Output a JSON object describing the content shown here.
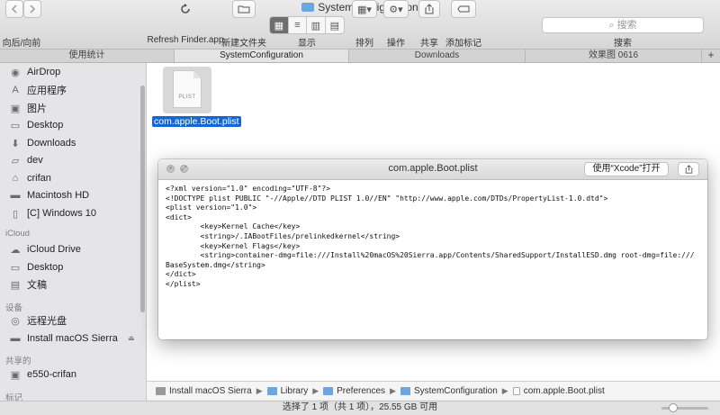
{
  "window": {
    "title": "SystemConfiguration"
  },
  "toolbar": {
    "back_forward_label": "向后/向前",
    "refresh_label": "Refresh Finder.app",
    "new_folder_label": "新建文件夹",
    "view_label": "显示",
    "arrange_label": "排列",
    "action_label": "操作",
    "share_label": "共享",
    "tags_label": "添加标记",
    "search_label": "搜索",
    "search_placeholder": "搜索"
  },
  "tabs": [
    {
      "label": "使用统计",
      "active": false
    },
    {
      "label": "SystemConfiguration",
      "active": true
    },
    {
      "label": "Downloads",
      "active": false
    },
    {
      "label": "效果图 0616",
      "active": false
    }
  ],
  "tab_add": "+",
  "sidebar": {
    "favorites": [
      {
        "label": "AirDrop",
        "icon": "airdrop-icon"
      },
      {
        "label": "应用程序",
        "icon": "applications-icon"
      },
      {
        "label": "图片",
        "icon": "camera-icon"
      },
      {
        "label": "Desktop",
        "icon": "desktop-icon"
      },
      {
        "label": "Downloads",
        "icon": "download-icon"
      },
      {
        "label": "dev",
        "icon": "folder-icon"
      },
      {
        "label": "crifan",
        "icon": "home-icon"
      },
      {
        "label": "Macintosh HD",
        "icon": "disk-icon"
      },
      {
        "label": "[C] Windows 10",
        "icon": "doc-icon"
      }
    ],
    "icloud_header": "iCloud",
    "icloud": [
      {
        "label": "iCloud Drive",
        "icon": "cloud-icon"
      },
      {
        "label": "Desktop",
        "icon": "desktop-icon"
      },
      {
        "label": "文稿",
        "icon": "document-icon"
      }
    ],
    "devices_header": "设备",
    "devices": [
      {
        "label": "远程光盘",
        "icon": "disc-icon"
      },
      {
        "label": "Install macOS Sierra",
        "icon": "disk-icon"
      }
    ],
    "shared_header": "共享的",
    "shared": [
      {
        "label": "e550-crifan",
        "icon": "monitor-icon"
      }
    ],
    "tags_header": "标记"
  },
  "file": {
    "name": "com.apple.Boot.plist",
    "extension": "PLIST"
  },
  "quicklook": {
    "title": "com.apple.Boot.plist",
    "open_with_label": "使用“Xcode”打开",
    "content": "<?xml version=\"1.0\" encoding=\"UTF-8\"?>\n<!DOCTYPE plist PUBLIC \"-//Apple//DTD PLIST 1.0//EN\" \"http://www.apple.com/DTDs/PropertyList-1.0.dtd\">\n<plist version=\"1.0\">\n<dict>\n        <key>Kernel Cache</key>\n        <string>/.IABootFiles/prelinkedkernel</string>\n        <key>Kernel Flags</key>\n        <string>container-dmg=file:///Install%20macOS%20Sierra.app/Contents/SharedSupport/InstallESD.dmg root-dmg=file:///BaseSystem.dmg</string>\n</dict>\n</plist>"
  },
  "pathbar": [
    {
      "label": "Install macOS Sierra",
      "kind": "disk"
    },
    {
      "label": "Library",
      "kind": "folder"
    },
    {
      "label": "Preferences",
      "kind": "folder"
    },
    {
      "label": "SystemConfiguration",
      "kind": "folder"
    },
    {
      "label": "com.apple.Boot.plist",
      "kind": "doc"
    }
  ],
  "status": {
    "text": "选择了 1 项（共 1 项），25.55 GB 可用"
  },
  "colors": {
    "selection": "#1565d8",
    "folder": "#6aa7e0",
    "active_toggle": "#6e6e6e"
  }
}
